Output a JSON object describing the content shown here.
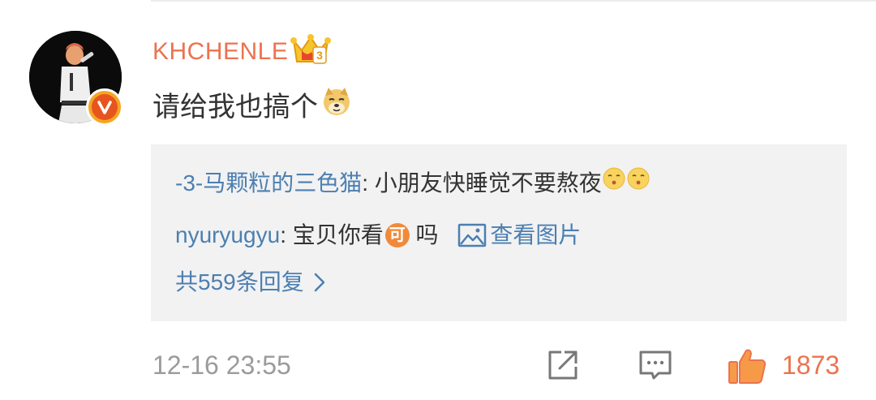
{
  "comment": {
    "username": "KHCHENLE",
    "text": "请给我也搞个",
    "emoji": "doge-emoji",
    "timestamp": "12-16 23:55",
    "like_count": "1873"
  },
  "replies": [
    {
      "user": "-3-马颗粒的三色猫",
      "separator": ": ",
      "text": "小朋友快睡觉不要熬夜",
      "emojis": [
        "shush-emoji",
        "shush-emoji"
      ]
    },
    {
      "user": "nyuryugyu",
      "separator": ": ",
      "text_before": "宝贝你看",
      "badge": "可",
      "text_after": " 吗 ",
      "image_link": "查看图片"
    }
  ],
  "more_replies": "共559条回复",
  "colors": {
    "username": "#eb7350",
    "link": "#4c7fb1",
    "text": "#333333",
    "meta": "#9b9b9b",
    "like": "#eb7350",
    "reply_bg": "#f2f2f2"
  },
  "icons": [
    "crown-badge-icon",
    "verified-v-icon",
    "image-icon",
    "chevron-right-icon",
    "share-icon",
    "reply-comment-icon",
    "thumbs-up-icon"
  ]
}
